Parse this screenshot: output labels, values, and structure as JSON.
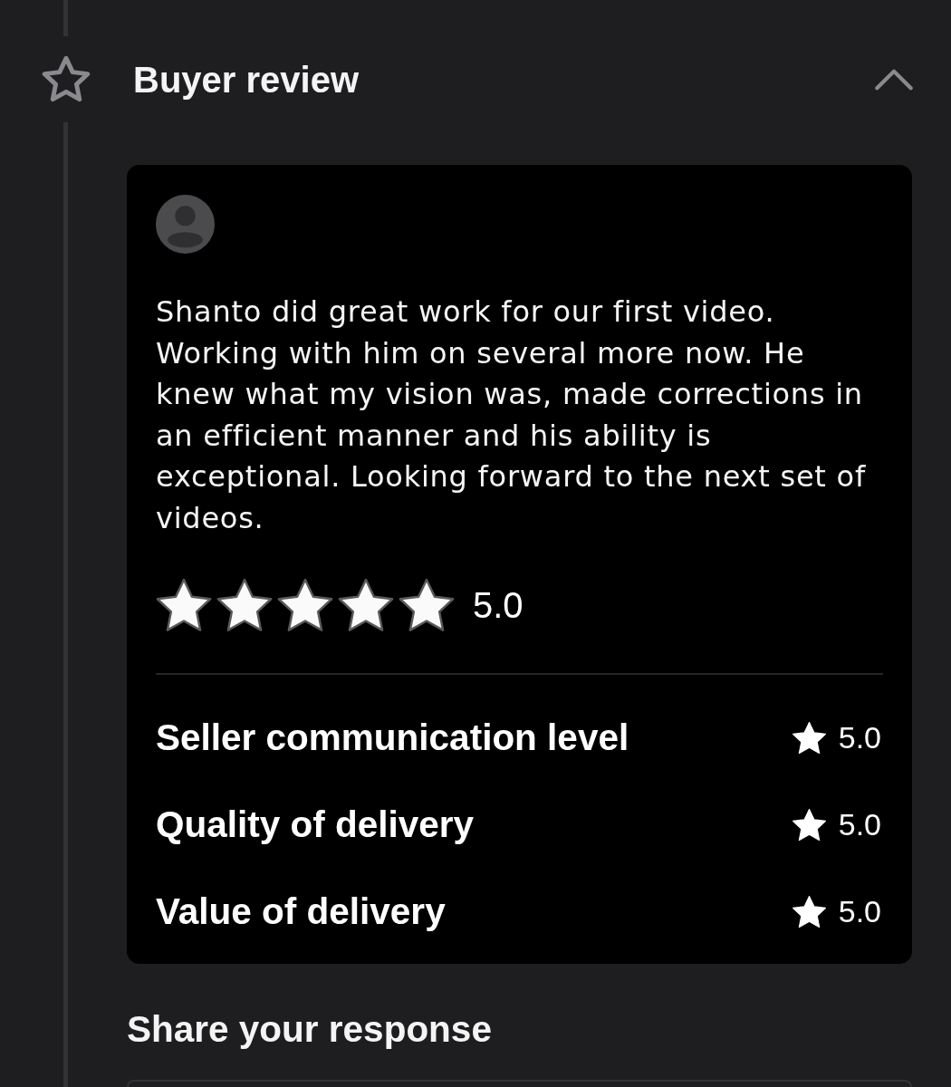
{
  "section": {
    "title": "Buyer review",
    "expanded": true
  },
  "review": {
    "text": "Shanto did great work for our first video. Working with him on several more now. He knew what my vision was, made corrections in an efficient manner and his ability is exceptional. Looking forward to the next set of videos.",
    "stars": 5,
    "rating": "5.0",
    "criteria": [
      {
        "label": "Seller communication level",
        "rating": "5.0"
      },
      {
        "label": "Quality of delivery",
        "rating": "5.0"
      },
      {
        "label": "Value of delivery",
        "rating": "5.0"
      }
    ]
  },
  "response": {
    "title": "Share your response"
  }
}
